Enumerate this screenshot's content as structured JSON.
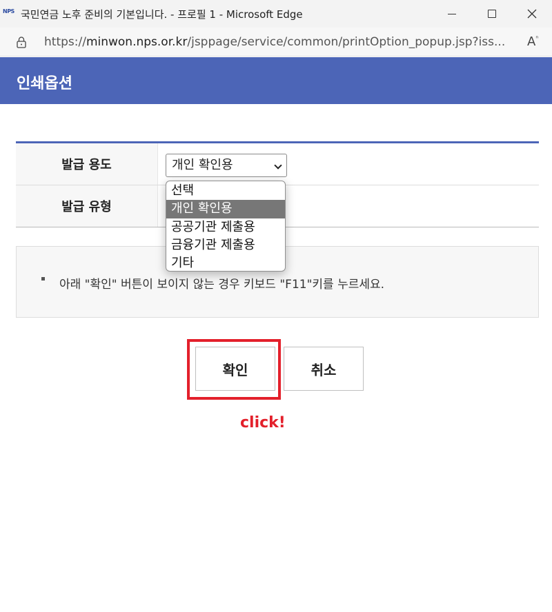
{
  "window": {
    "logo_text": "NPS",
    "title": "국민연금 노후 준비의 기본입니다. - 프로필 1 - Microsoft Edge"
  },
  "address_bar": {
    "url_prefix": "https://",
    "url_host": "minwon.nps.or.kr",
    "url_path": "/jsppage/service/common/printOption_popup.jsp?iss..."
  },
  "page": {
    "title": "인쇄옵션"
  },
  "options": {
    "purpose_label": "발급 용도",
    "purpose_selected": "개인 확인용",
    "type_label": "발급 유형",
    "dropdown_items": [
      "선택",
      "개인 확인용",
      "공공기관 제출용",
      "금융기관 제출용",
      "기타"
    ],
    "dropdown_highlighted_index": 1
  },
  "notice": {
    "text": "아래 \"확인\" 버튼이 보이지 않는 경우 키보드 \"F11\"키를 누르세요."
  },
  "buttons": {
    "ok_label": "확인",
    "cancel_label": "취소"
  },
  "annotation": {
    "text": "click!",
    "color": "#e3202b"
  },
  "colors": {
    "header_bg": "#4c65b7",
    "highlight": "#e3202b"
  }
}
